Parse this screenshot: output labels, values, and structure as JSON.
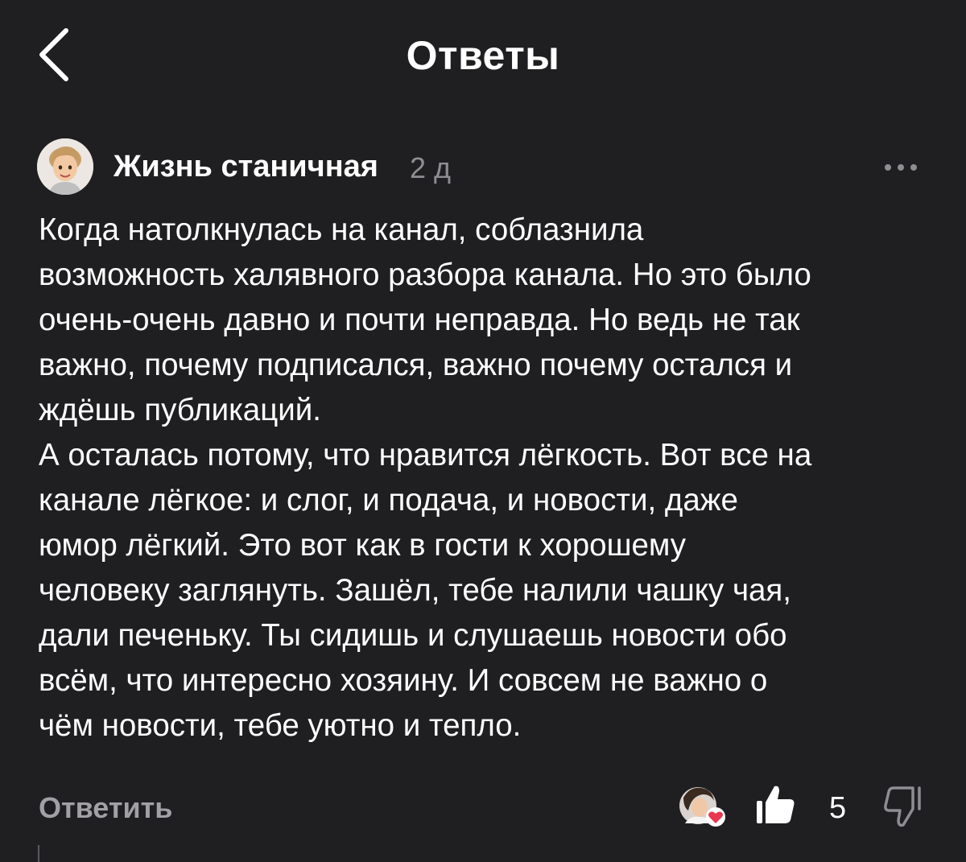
{
  "header": {
    "title": "Ответы",
    "back_icon": "chevron-left-icon"
  },
  "comment": {
    "author": "Жизнь станичная",
    "time": "2 д",
    "avatar_icon": "author-avatar",
    "more_icon": "more-horizontal-icon",
    "text": "Когда натолкнулась на канал, соблазнила\nвозможность халявного разбора канала. Но это было\nочень-очень давно и почти неправда. Но ведь не так\nважно, почему подписался, важно почему остался и\nждёшь публикаций.\nА осталась потому, что нравится лёгкость. Вот все на\nканале лёгкое: и слог, и подача, и новости, даже\nюмор лёгкий. Это вот как в гости к хорошему\nчеловеку заглянуть. Зашёл, тебе налили чашку чая,\nдали печеньку. Ты сидишь и слушаешь новости обо\nвсём, что интересно хозяину. И совсем не важно о\nчём новости, тебе уютно и тепло."
  },
  "footer": {
    "reply_label": "Ответить",
    "like_count": "5",
    "like_icon": "thumbs-up-icon",
    "dislike_icon": "thumbs-down-icon",
    "liked_by_author_icon": "heart-icon"
  },
  "colors": {
    "background": "#1f1f21",
    "text": "#ffffff",
    "muted": "#8d8d92",
    "heart": "#e8384f"
  }
}
